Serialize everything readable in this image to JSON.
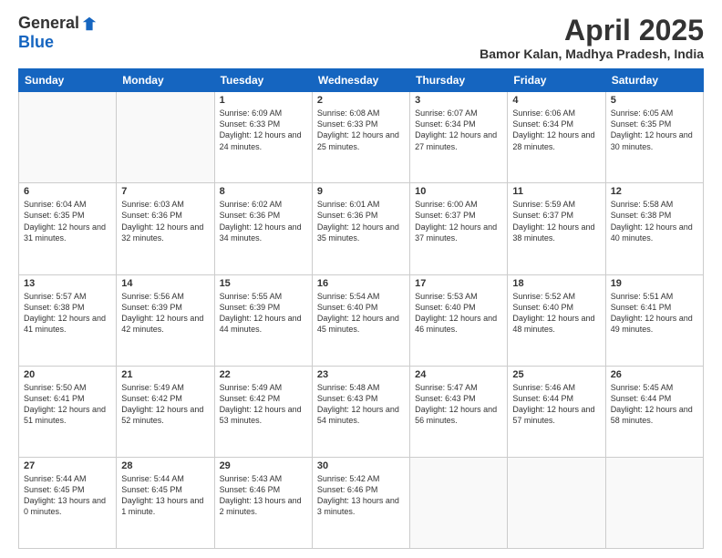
{
  "header": {
    "logo_general": "General",
    "logo_blue": "Blue",
    "month": "April 2025",
    "location": "Bamor Kalan, Madhya Pradesh, India"
  },
  "days_of_week": [
    "Sunday",
    "Monday",
    "Tuesday",
    "Wednesday",
    "Thursday",
    "Friday",
    "Saturday"
  ],
  "weeks": [
    [
      {
        "day": "",
        "sunrise": "",
        "sunset": "",
        "daylight": ""
      },
      {
        "day": "",
        "sunrise": "",
        "sunset": "",
        "daylight": ""
      },
      {
        "day": "1",
        "sunrise": "Sunrise: 6:09 AM",
        "sunset": "Sunset: 6:33 PM",
        "daylight": "Daylight: 12 hours and 24 minutes."
      },
      {
        "day": "2",
        "sunrise": "Sunrise: 6:08 AM",
        "sunset": "Sunset: 6:33 PM",
        "daylight": "Daylight: 12 hours and 25 minutes."
      },
      {
        "day": "3",
        "sunrise": "Sunrise: 6:07 AM",
        "sunset": "Sunset: 6:34 PM",
        "daylight": "Daylight: 12 hours and 27 minutes."
      },
      {
        "day": "4",
        "sunrise": "Sunrise: 6:06 AM",
        "sunset": "Sunset: 6:34 PM",
        "daylight": "Daylight: 12 hours and 28 minutes."
      },
      {
        "day": "5",
        "sunrise": "Sunrise: 6:05 AM",
        "sunset": "Sunset: 6:35 PM",
        "daylight": "Daylight: 12 hours and 30 minutes."
      }
    ],
    [
      {
        "day": "6",
        "sunrise": "Sunrise: 6:04 AM",
        "sunset": "Sunset: 6:35 PM",
        "daylight": "Daylight: 12 hours and 31 minutes."
      },
      {
        "day": "7",
        "sunrise": "Sunrise: 6:03 AM",
        "sunset": "Sunset: 6:36 PM",
        "daylight": "Daylight: 12 hours and 32 minutes."
      },
      {
        "day": "8",
        "sunrise": "Sunrise: 6:02 AM",
        "sunset": "Sunset: 6:36 PM",
        "daylight": "Daylight: 12 hours and 34 minutes."
      },
      {
        "day": "9",
        "sunrise": "Sunrise: 6:01 AM",
        "sunset": "Sunset: 6:36 PM",
        "daylight": "Daylight: 12 hours and 35 minutes."
      },
      {
        "day": "10",
        "sunrise": "Sunrise: 6:00 AM",
        "sunset": "Sunset: 6:37 PM",
        "daylight": "Daylight: 12 hours and 37 minutes."
      },
      {
        "day": "11",
        "sunrise": "Sunrise: 5:59 AM",
        "sunset": "Sunset: 6:37 PM",
        "daylight": "Daylight: 12 hours and 38 minutes."
      },
      {
        "day": "12",
        "sunrise": "Sunrise: 5:58 AM",
        "sunset": "Sunset: 6:38 PM",
        "daylight": "Daylight: 12 hours and 40 minutes."
      }
    ],
    [
      {
        "day": "13",
        "sunrise": "Sunrise: 5:57 AM",
        "sunset": "Sunset: 6:38 PM",
        "daylight": "Daylight: 12 hours and 41 minutes."
      },
      {
        "day": "14",
        "sunrise": "Sunrise: 5:56 AM",
        "sunset": "Sunset: 6:39 PM",
        "daylight": "Daylight: 12 hours and 42 minutes."
      },
      {
        "day": "15",
        "sunrise": "Sunrise: 5:55 AM",
        "sunset": "Sunset: 6:39 PM",
        "daylight": "Daylight: 12 hours and 44 minutes."
      },
      {
        "day": "16",
        "sunrise": "Sunrise: 5:54 AM",
        "sunset": "Sunset: 6:40 PM",
        "daylight": "Daylight: 12 hours and 45 minutes."
      },
      {
        "day": "17",
        "sunrise": "Sunrise: 5:53 AM",
        "sunset": "Sunset: 6:40 PM",
        "daylight": "Daylight: 12 hours and 46 minutes."
      },
      {
        "day": "18",
        "sunrise": "Sunrise: 5:52 AM",
        "sunset": "Sunset: 6:40 PM",
        "daylight": "Daylight: 12 hours and 48 minutes."
      },
      {
        "day": "19",
        "sunrise": "Sunrise: 5:51 AM",
        "sunset": "Sunset: 6:41 PM",
        "daylight": "Daylight: 12 hours and 49 minutes."
      }
    ],
    [
      {
        "day": "20",
        "sunrise": "Sunrise: 5:50 AM",
        "sunset": "Sunset: 6:41 PM",
        "daylight": "Daylight: 12 hours and 51 minutes."
      },
      {
        "day": "21",
        "sunrise": "Sunrise: 5:49 AM",
        "sunset": "Sunset: 6:42 PM",
        "daylight": "Daylight: 12 hours and 52 minutes."
      },
      {
        "day": "22",
        "sunrise": "Sunrise: 5:49 AM",
        "sunset": "Sunset: 6:42 PM",
        "daylight": "Daylight: 12 hours and 53 minutes."
      },
      {
        "day": "23",
        "sunrise": "Sunrise: 5:48 AM",
        "sunset": "Sunset: 6:43 PM",
        "daylight": "Daylight: 12 hours and 54 minutes."
      },
      {
        "day": "24",
        "sunrise": "Sunrise: 5:47 AM",
        "sunset": "Sunset: 6:43 PM",
        "daylight": "Daylight: 12 hours and 56 minutes."
      },
      {
        "day": "25",
        "sunrise": "Sunrise: 5:46 AM",
        "sunset": "Sunset: 6:44 PM",
        "daylight": "Daylight: 12 hours and 57 minutes."
      },
      {
        "day": "26",
        "sunrise": "Sunrise: 5:45 AM",
        "sunset": "Sunset: 6:44 PM",
        "daylight": "Daylight: 12 hours and 58 minutes."
      }
    ],
    [
      {
        "day": "27",
        "sunrise": "Sunrise: 5:44 AM",
        "sunset": "Sunset: 6:45 PM",
        "daylight": "Daylight: 13 hours and 0 minutes."
      },
      {
        "day": "28",
        "sunrise": "Sunrise: 5:44 AM",
        "sunset": "Sunset: 6:45 PM",
        "daylight": "Daylight: 13 hours and 1 minute."
      },
      {
        "day": "29",
        "sunrise": "Sunrise: 5:43 AM",
        "sunset": "Sunset: 6:46 PM",
        "daylight": "Daylight: 13 hours and 2 minutes."
      },
      {
        "day": "30",
        "sunrise": "Sunrise: 5:42 AM",
        "sunset": "Sunset: 6:46 PM",
        "daylight": "Daylight: 13 hours and 3 minutes."
      },
      {
        "day": "",
        "sunrise": "",
        "sunset": "",
        "daylight": ""
      },
      {
        "day": "",
        "sunrise": "",
        "sunset": "",
        "daylight": ""
      },
      {
        "day": "",
        "sunrise": "",
        "sunset": "",
        "daylight": ""
      }
    ]
  ]
}
